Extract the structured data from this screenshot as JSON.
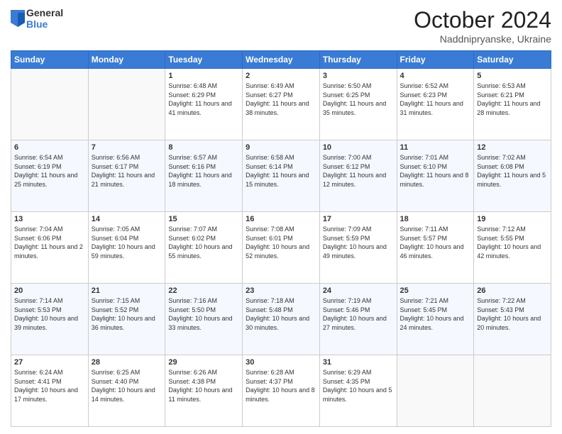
{
  "header": {
    "logo_line1": "General",
    "logo_line2": "Blue",
    "month": "October 2024",
    "location": "Naddnipryanske, Ukraine"
  },
  "days_of_week": [
    "Sunday",
    "Monday",
    "Tuesday",
    "Wednesday",
    "Thursday",
    "Friday",
    "Saturday"
  ],
  "weeks": [
    [
      {
        "day": "",
        "info": ""
      },
      {
        "day": "",
        "info": ""
      },
      {
        "day": "1",
        "info": "Sunrise: 6:48 AM\nSunset: 6:29 PM\nDaylight: 11 hours and 41 minutes."
      },
      {
        "day": "2",
        "info": "Sunrise: 6:49 AM\nSunset: 6:27 PM\nDaylight: 11 hours and 38 minutes."
      },
      {
        "day": "3",
        "info": "Sunrise: 6:50 AM\nSunset: 6:25 PM\nDaylight: 11 hours and 35 minutes."
      },
      {
        "day": "4",
        "info": "Sunrise: 6:52 AM\nSunset: 6:23 PM\nDaylight: 11 hours and 31 minutes."
      },
      {
        "day": "5",
        "info": "Sunrise: 6:53 AM\nSunset: 6:21 PM\nDaylight: 11 hours and 28 minutes."
      }
    ],
    [
      {
        "day": "6",
        "info": "Sunrise: 6:54 AM\nSunset: 6:19 PM\nDaylight: 11 hours and 25 minutes."
      },
      {
        "day": "7",
        "info": "Sunrise: 6:56 AM\nSunset: 6:17 PM\nDaylight: 11 hours and 21 minutes."
      },
      {
        "day": "8",
        "info": "Sunrise: 6:57 AM\nSunset: 6:16 PM\nDaylight: 11 hours and 18 minutes."
      },
      {
        "day": "9",
        "info": "Sunrise: 6:58 AM\nSunset: 6:14 PM\nDaylight: 11 hours and 15 minutes."
      },
      {
        "day": "10",
        "info": "Sunrise: 7:00 AM\nSunset: 6:12 PM\nDaylight: 11 hours and 12 minutes."
      },
      {
        "day": "11",
        "info": "Sunrise: 7:01 AM\nSunset: 6:10 PM\nDaylight: 11 hours and 8 minutes."
      },
      {
        "day": "12",
        "info": "Sunrise: 7:02 AM\nSunset: 6:08 PM\nDaylight: 11 hours and 5 minutes."
      }
    ],
    [
      {
        "day": "13",
        "info": "Sunrise: 7:04 AM\nSunset: 6:06 PM\nDaylight: 11 hours and 2 minutes."
      },
      {
        "day": "14",
        "info": "Sunrise: 7:05 AM\nSunset: 6:04 PM\nDaylight: 10 hours and 59 minutes."
      },
      {
        "day": "15",
        "info": "Sunrise: 7:07 AM\nSunset: 6:02 PM\nDaylight: 10 hours and 55 minutes."
      },
      {
        "day": "16",
        "info": "Sunrise: 7:08 AM\nSunset: 6:01 PM\nDaylight: 10 hours and 52 minutes."
      },
      {
        "day": "17",
        "info": "Sunrise: 7:09 AM\nSunset: 5:59 PM\nDaylight: 10 hours and 49 minutes."
      },
      {
        "day": "18",
        "info": "Sunrise: 7:11 AM\nSunset: 5:57 PM\nDaylight: 10 hours and 46 minutes."
      },
      {
        "day": "19",
        "info": "Sunrise: 7:12 AM\nSunset: 5:55 PM\nDaylight: 10 hours and 42 minutes."
      }
    ],
    [
      {
        "day": "20",
        "info": "Sunrise: 7:14 AM\nSunset: 5:53 PM\nDaylight: 10 hours and 39 minutes."
      },
      {
        "day": "21",
        "info": "Sunrise: 7:15 AM\nSunset: 5:52 PM\nDaylight: 10 hours and 36 minutes."
      },
      {
        "day": "22",
        "info": "Sunrise: 7:16 AM\nSunset: 5:50 PM\nDaylight: 10 hours and 33 minutes."
      },
      {
        "day": "23",
        "info": "Sunrise: 7:18 AM\nSunset: 5:48 PM\nDaylight: 10 hours and 30 minutes."
      },
      {
        "day": "24",
        "info": "Sunrise: 7:19 AM\nSunset: 5:46 PM\nDaylight: 10 hours and 27 minutes."
      },
      {
        "day": "25",
        "info": "Sunrise: 7:21 AM\nSunset: 5:45 PM\nDaylight: 10 hours and 24 minutes."
      },
      {
        "day": "26",
        "info": "Sunrise: 7:22 AM\nSunset: 5:43 PM\nDaylight: 10 hours and 20 minutes."
      }
    ],
    [
      {
        "day": "27",
        "info": "Sunrise: 6:24 AM\nSunset: 4:41 PM\nDaylight: 10 hours and 17 minutes."
      },
      {
        "day": "28",
        "info": "Sunrise: 6:25 AM\nSunset: 4:40 PM\nDaylight: 10 hours and 14 minutes."
      },
      {
        "day": "29",
        "info": "Sunrise: 6:26 AM\nSunset: 4:38 PM\nDaylight: 10 hours and 11 minutes."
      },
      {
        "day": "30",
        "info": "Sunrise: 6:28 AM\nSunset: 4:37 PM\nDaylight: 10 hours and 8 minutes."
      },
      {
        "day": "31",
        "info": "Sunrise: 6:29 AM\nSunset: 4:35 PM\nDaylight: 10 hours and 5 minutes."
      },
      {
        "day": "",
        "info": ""
      },
      {
        "day": "",
        "info": ""
      }
    ]
  ]
}
